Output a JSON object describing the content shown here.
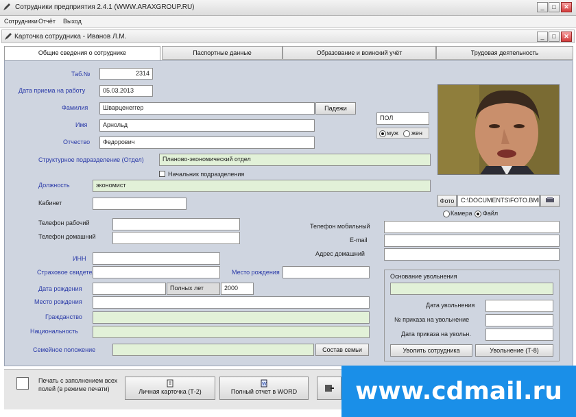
{
  "app": {
    "title": "Сотрудники предприятия 2.4.1 (WWW.ARAXGROUP.RU)",
    "menu": [
      "Сотрудники",
      "Отчёт",
      "Выход"
    ],
    "window_buttons": [
      "_",
      "□",
      "✕"
    ]
  },
  "child_window": {
    "title": "Карточка сотрудника - Иванов Л.М.",
    "buttons": [
      "_",
      "□",
      "✕"
    ]
  },
  "tabs": [
    "Общие сведения о сотруднике",
    "Паспортные данные",
    "Образование и воинский учёт",
    "Трудовая деятельность"
  ],
  "form": {
    "tab_number_label": "Таб.№",
    "tab_number_value": "2314",
    "hire_date_label": "Дата приема на работу",
    "hire_date_value": "05.03.2013",
    "surname_label": "Фамилия",
    "surname_value": "Шварценеггер",
    "declension_button": "Падежи",
    "name_label": "Имя",
    "name_value": "Арнольд",
    "patronymic_label": "Отчество",
    "patronymic_value": "Федорович",
    "gender_label": "ПОЛ",
    "gender_male": "муж",
    "gender_female": "жен",
    "department_label": "Структурное подразделение (Отдел)",
    "department_value": "Планово-экономический отдел",
    "dept_head_checkbox": "Начальник подразделения",
    "position_label": "Должность",
    "position_value": "экономист",
    "office_label": "Кабинет",
    "office_value": "",
    "work_phone_label": "Телефон рабочий",
    "work_phone_value": "",
    "home_phone_label": "Телефон домашний",
    "home_phone_value": "",
    "mobile_phone_label": "Телефон мобильный",
    "mobile_phone_value": "",
    "email_label": "E-mail",
    "email_value": "",
    "home_address_label": "Адрес домашний",
    "home_address_value": "",
    "inn_label": "ИНН",
    "inn_value": "",
    "pension_label": "Страховое свидетельство",
    "pension_value": "",
    "birth_place_label": "Место рождения",
    "birth_place_value": "",
    "birth_date_label": "Дата рождения",
    "birth_date_value": "",
    "full_years_label": "Полных лет",
    "full_years_value": "2000",
    "birth_place2_label": "Место рождения",
    "birth_place2_value": "",
    "citizenship_label": "Гражданство",
    "citizenship_value": "",
    "nationality_label": "Национальность",
    "nationality_value": "",
    "family_label": "Семейное положение",
    "family_value": "",
    "family_button": "Состав семьи",
    "photo_button": "Фото",
    "photo_path": "C:\\DOCUMENTS\\FOTO.BMP",
    "photo_source_camera": "Камера",
    "photo_source_file": "Файл",
    "dismissal_group_label": "Основание увольнения",
    "dismissal_value": "",
    "dismissal_date_label": "Дата увольнения",
    "dismissal_date_value": "",
    "dismissal_order_label": "№ приказа на увольнение",
    "dismissal_order_value": "",
    "dismissal_order_date_label": "Дата приказа на увольн.",
    "dismissal_order_date_value": "",
    "dismiss_button": "Уволить сотрудника",
    "dismissal_print_button": "Увольнение (Т-8)"
  },
  "footer": {
    "checkbox_label_line1": "Печать с заполнением всех",
    "checkbox_label_line2": "полей (в режиме печати)",
    "print_t2_button": "Личная карточка (Т-2)",
    "print_word_button": "Полный отчет в WORD",
    "close_button": ""
  },
  "watermark": "www.cdmail.ru",
  "colors": {
    "panel": "#cfd5e0",
    "field_green": "#e2f1d8",
    "label_blue": "#2a3aa8",
    "watermark_bg": "#1a8fe8"
  }
}
